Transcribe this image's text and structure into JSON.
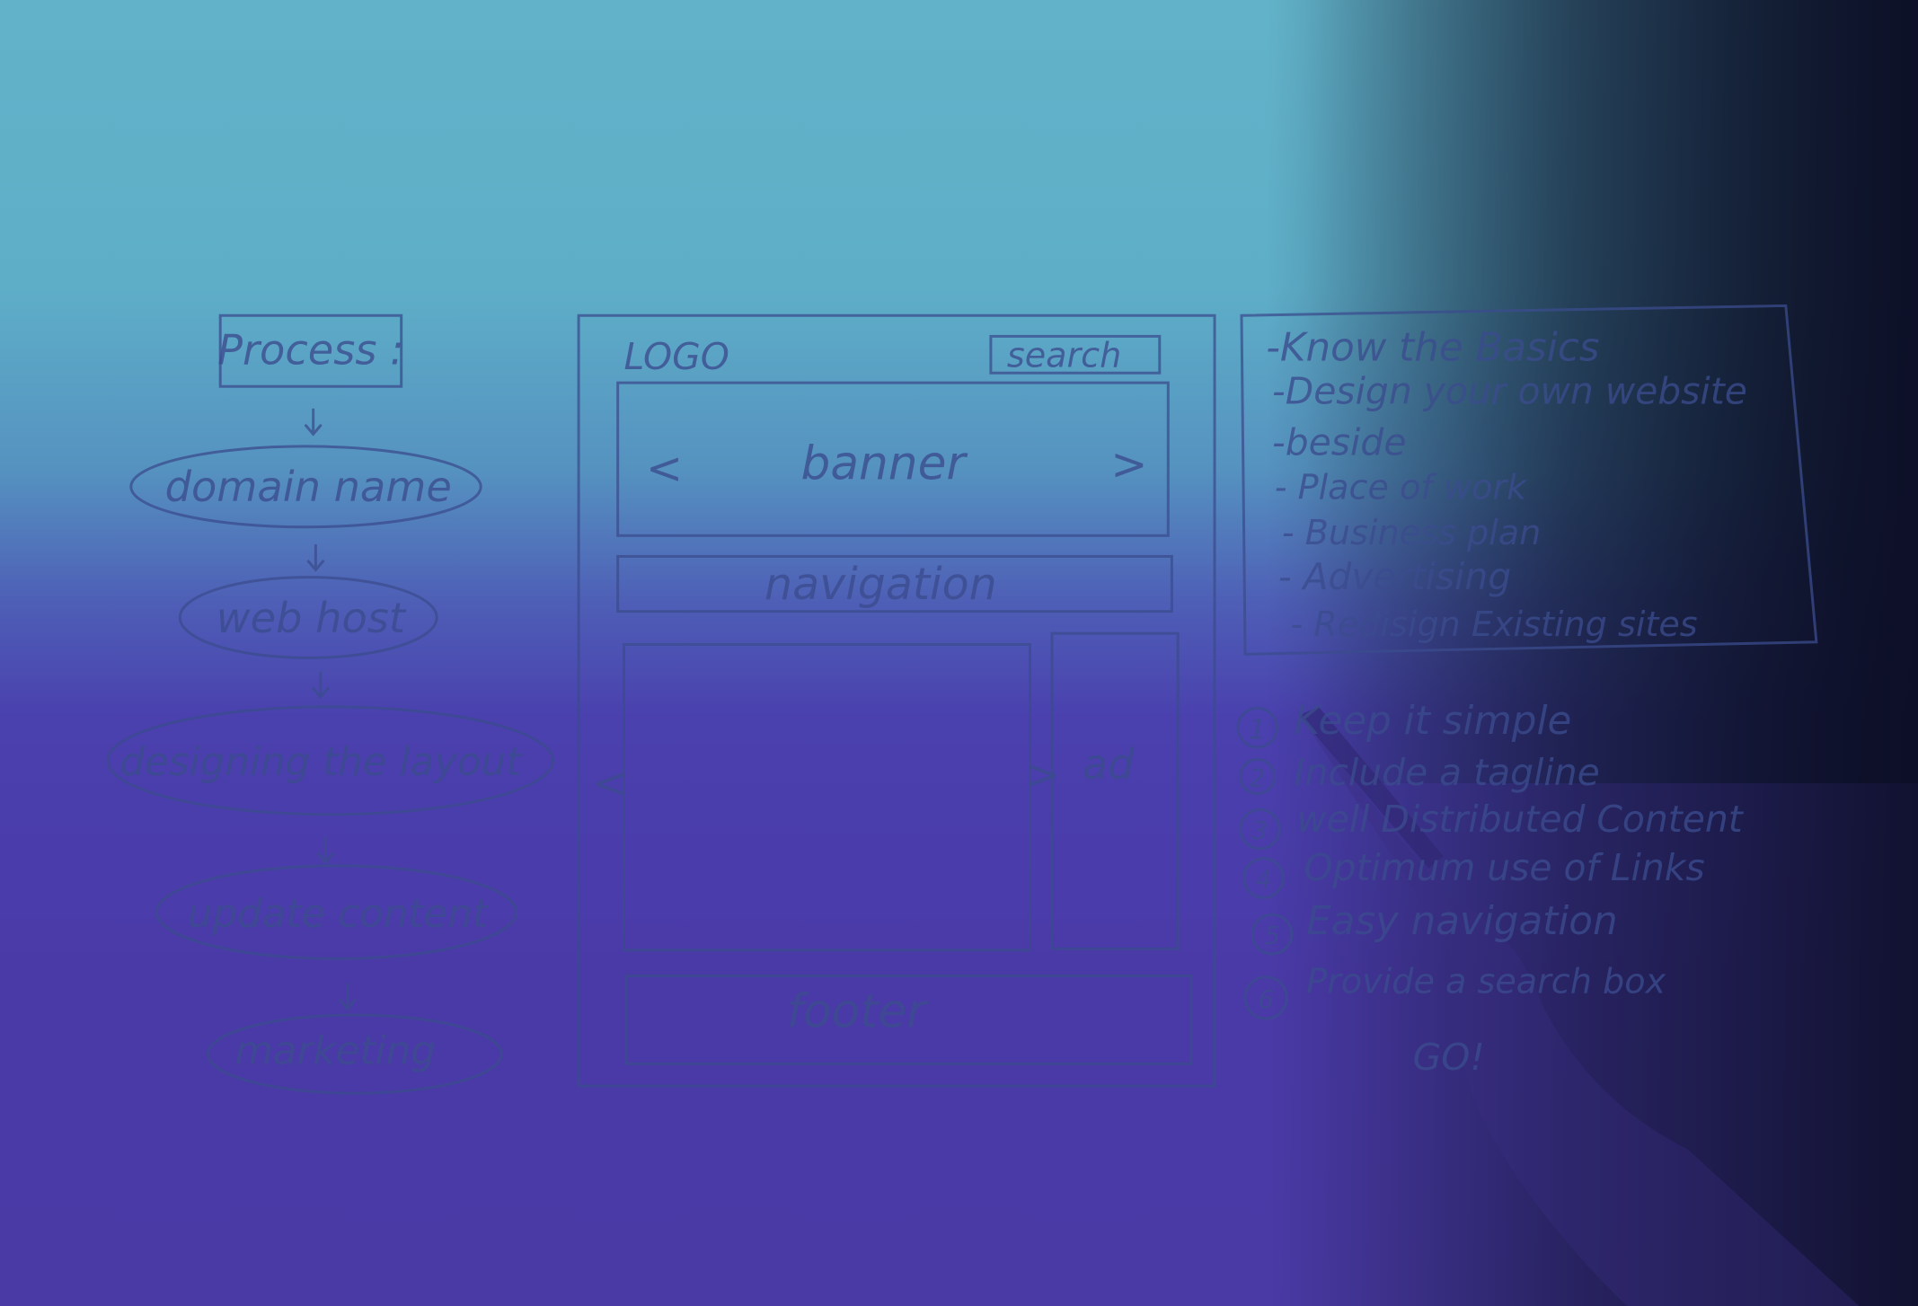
{
  "process": {
    "title": "Process :",
    "steps": [
      "domain name",
      "web host",
      "designing the layout",
      "update content",
      "marketing"
    ]
  },
  "wireframe": {
    "logo": "LOGO",
    "search": "search",
    "banner": "banner",
    "prev_arrow": "<",
    "next_arrow": ">",
    "navigation": "navigation",
    "ad": "ad",
    "footer": "footer"
  },
  "basics": {
    "items": [
      "-Know the Basics",
      "-Design your own website",
      "-beside",
      "- Place of work",
      "- Business plan",
      "- Advertising",
      "- Redisign Existing sites"
    ]
  },
  "tips": {
    "numbers": [
      "1",
      "2",
      "3",
      "4",
      "5",
      "6"
    ],
    "items": [
      "Keep it simple",
      "Include a tagline",
      "well Distributed Content",
      "Optimum use of Links",
      "Easy navigation",
      "Provide a search box"
    ],
    "closing": "GO!"
  },
  "colors": {
    "top": "#62b3c9",
    "bottom": "#4a3aa8",
    "ink": "#3b4c8e",
    "dark_corner": "#0e1230"
  }
}
